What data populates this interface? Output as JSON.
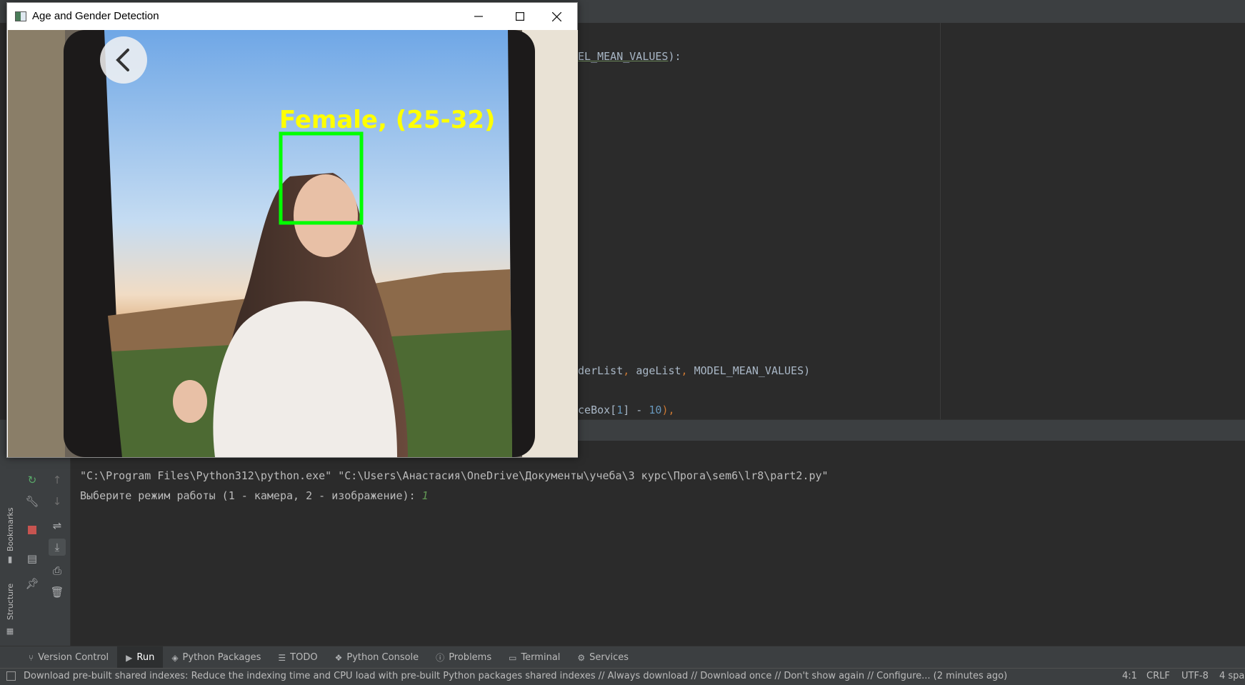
{
  "window": {
    "title": "Age and Gender Detection",
    "minimize_icon": "minimize-icon",
    "maximize_icon": "maximize-icon",
    "close_icon": "close-icon",
    "detection_label": "Female, (25-32)",
    "label_color": "#ffff00",
    "box_color": "#00ff00",
    "back_icon": "chevron-left-icon"
  },
  "editor": {
    "line1_a": "DEL_MEAN_VALUES",
    "line1_b": "):",
    "line2_a": "nderList",
    "line2_b": ", ",
    "line2_c": "ageList",
    "line2_d": ", ",
    "line2_e": "MODEL_MEAN_VALUES)",
    "line3_a": "aceBox[",
    "line3_b": "1",
    "line3_c": "] - ",
    "line3_d": "10",
    "line3_e": "),"
  },
  "sidebar": {
    "bookmarks_label": "Bookmarks",
    "structure_label": "Structure"
  },
  "console": {
    "command": "\"C:\\Program Files\\Python312\\python.exe\" \"C:\\Users\\Анастасия\\OneDrive\\Документы\\учеба\\3 курс\\Прога\\sem6\\lr8\\part2.py\"",
    "prompt": "Выберите режим работы (1 - камера, 2 - изображение): ",
    "input": "1"
  },
  "bottom_tabs": [
    {
      "label": "Version Control",
      "icon": "branch-icon"
    },
    {
      "label": "Run",
      "icon": "run-icon"
    },
    {
      "label": "Python Packages",
      "icon": "layers-icon"
    },
    {
      "label": "TODO",
      "icon": "list-icon"
    },
    {
      "label": "Python Console",
      "icon": "python-icon"
    },
    {
      "label": "Problems",
      "icon": "info-icon"
    },
    {
      "label": "Terminal",
      "icon": "terminal-icon"
    },
    {
      "label": "Services",
      "icon": "services-icon"
    }
  ],
  "status": {
    "message": "Download pre-built shared indexes: Reduce the indexing time and CPU load with pre-built Python packages shared indexes // Always download // Download once // Don't show again // Configure... (2 minutes ago)",
    "position": "4:1",
    "line_sep": "CRLF",
    "encoding": "UTF-8",
    "indent": "4 spa"
  }
}
